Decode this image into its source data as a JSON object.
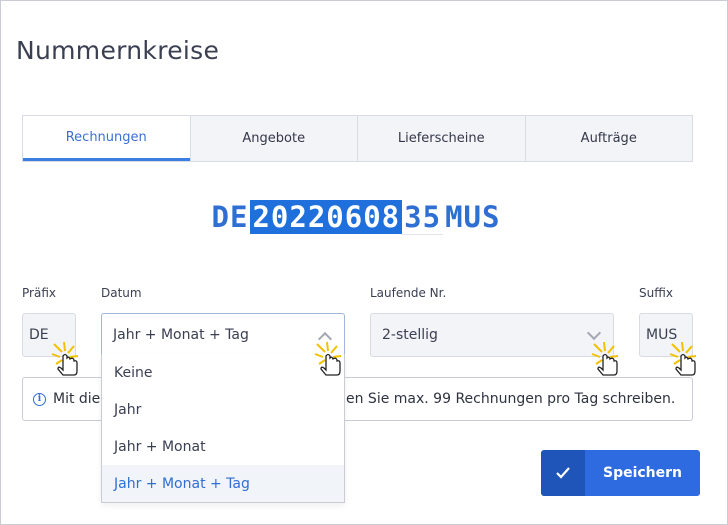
{
  "page": {
    "title": "Nummernkreise"
  },
  "tabs": [
    {
      "label": "Rechnungen",
      "active": true
    },
    {
      "label": "Angebote",
      "active": false
    },
    {
      "label": "Lieferscheine",
      "active": false
    },
    {
      "label": "Aufträge",
      "active": false
    }
  ],
  "preview": {
    "prefix": "DE",
    "date": "20220608",
    "number": "35",
    "suffix": "MUS"
  },
  "fields": {
    "praefix": {
      "label": "Präfix",
      "value": "DE"
    },
    "datum": {
      "label": "Datum",
      "value": "Jahr + Monat + Tag"
    },
    "laufende": {
      "label": "Laufende Nr.",
      "value": "2-stellig"
    },
    "suffix": {
      "label": "Suffix",
      "value": "MUS"
    }
  },
  "dropdown_options": [
    "Keine",
    "Jahr",
    "Jahr + Monat",
    "Jahr + Monat + Tag"
  ],
  "info": {
    "left": "Mit dies",
    "right": "en Sie max. 99 Rechnungen pro Tag schreiben.",
    "icon": "info-icon"
  },
  "save_button": {
    "label": "Speichern",
    "icon": "check-icon"
  },
  "colors": {
    "accent": "#2e6be0",
    "accent_dark": "#1f54b8",
    "highlight": "#1f6fdc"
  }
}
